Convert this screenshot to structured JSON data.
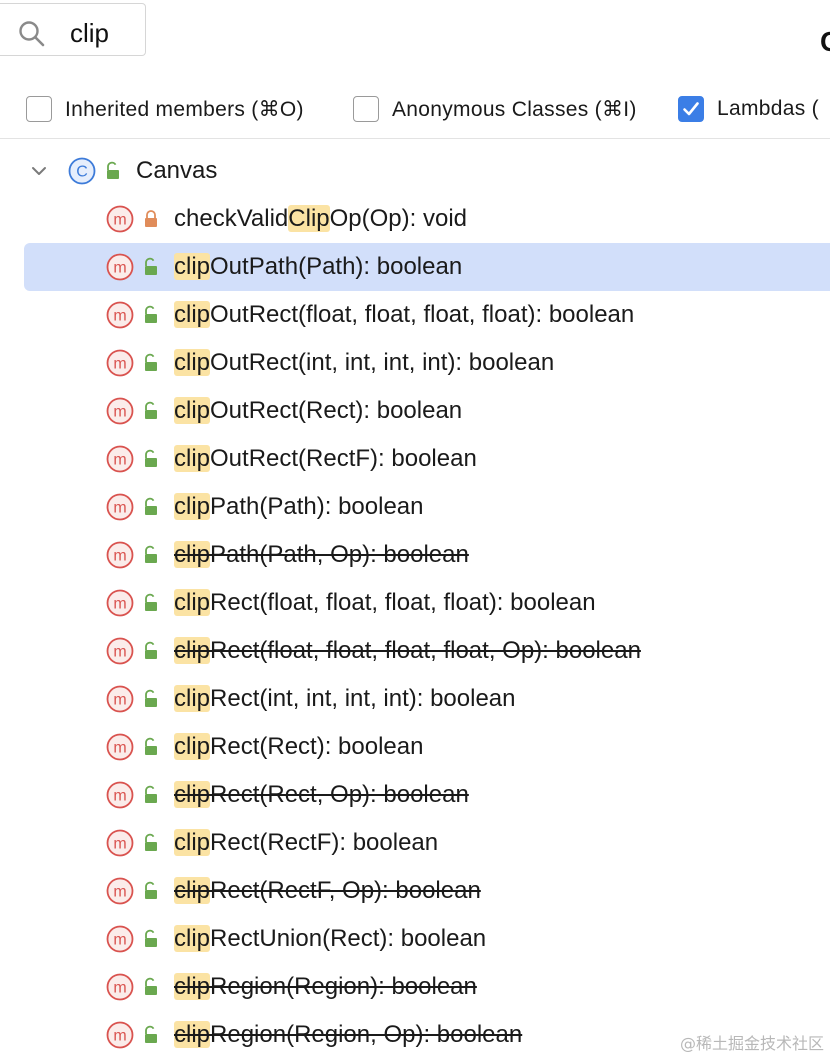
{
  "search": {
    "query": "clip",
    "icon": "search-icon"
  },
  "header": {
    "cut_title": "C"
  },
  "filters": [
    {
      "label": "Inherited members (⌘O)",
      "checked": false
    },
    {
      "label": "Anonymous Classes (⌘I)",
      "checked": false
    },
    {
      "label": "Lambdas (",
      "checked": true
    }
  ],
  "tree": {
    "class_name": "Canvas",
    "class_icon": "class-icon",
    "expanded": true,
    "members": [
      {
        "prefix": "checkValid",
        "match": "Clip",
        "rest": "Op(Op): void",
        "deprecated": false,
        "visibility": "private"
      },
      {
        "prefix": "",
        "match": "clip",
        "rest": "OutPath(Path): boolean",
        "deprecated": false,
        "visibility": "public",
        "selected": true
      },
      {
        "prefix": "",
        "match": "clip",
        "rest": "OutRect(float, float, float, float): boolean",
        "deprecated": false,
        "visibility": "public"
      },
      {
        "prefix": "",
        "match": "clip",
        "rest": "OutRect(int, int, int, int): boolean",
        "deprecated": false,
        "visibility": "public"
      },
      {
        "prefix": "",
        "match": "clip",
        "rest": "OutRect(Rect): boolean",
        "deprecated": false,
        "visibility": "public"
      },
      {
        "prefix": "",
        "match": "clip",
        "rest": "OutRect(RectF): boolean",
        "deprecated": false,
        "visibility": "public"
      },
      {
        "prefix": "",
        "match": "clip",
        "rest": "Path(Path): boolean",
        "deprecated": false,
        "visibility": "public"
      },
      {
        "prefix": "",
        "match": "clip",
        "rest": "Path(Path, Op): boolean",
        "deprecated": true,
        "visibility": "public"
      },
      {
        "prefix": "",
        "match": "clip",
        "rest": "Rect(float, float, float, float): boolean",
        "deprecated": false,
        "visibility": "public"
      },
      {
        "prefix": "",
        "match": "clip",
        "rest": "Rect(float, float, float, float, Op): boolean",
        "deprecated": true,
        "visibility": "public"
      },
      {
        "prefix": "",
        "match": "clip",
        "rest": "Rect(int, int, int, int): boolean",
        "deprecated": false,
        "visibility": "public"
      },
      {
        "prefix": "",
        "match": "clip",
        "rest": "Rect(Rect): boolean",
        "deprecated": false,
        "visibility": "public"
      },
      {
        "prefix": "",
        "match": "clip",
        "rest": "Rect(Rect, Op): boolean",
        "deprecated": true,
        "visibility": "public"
      },
      {
        "prefix": "",
        "match": "clip",
        "rest": "Rect(RectF): boolean",
        "deprecated": false,
        "visibility": "public"
      },
      {
        "prefix": "",
        "match": "clip",
        "rest": "Rect(RectF, Op): boolean",
        "deprecated": true,
        "visibility": "public"
      },
      {
        "prefix": "",
        "match": "clip",
        "rest": "RectUnion(Rect): boolean",
        "deprecated": false,
        "visibility": "public"
      },
      {
        "prefix": "",
        "match": "clip",
        "rest": "Region(Region): boolean",
        "deprecated": true,
        "visibility": "public"
      },
      {
        "prefix": "",
        "match": "clip",
        "rest": "Region(Region, Op): boolean",
        "deprecated": true,
        "visibility": "public"
      }
    ]
  },
  "watermark": "@稀土掘金技术社区",
  "colors": {
    "selection": "#d2dffa",
    "match_highlight": "#fbe3a4",
    "method_icon": "#d9534f",
    "class_icon": "#3d7bd9",
    "public_lock": "#6aa84f",
    "private_lock": "#e08c5a",
    "checkbox_checked": "#3b7ee6"
  }
}
